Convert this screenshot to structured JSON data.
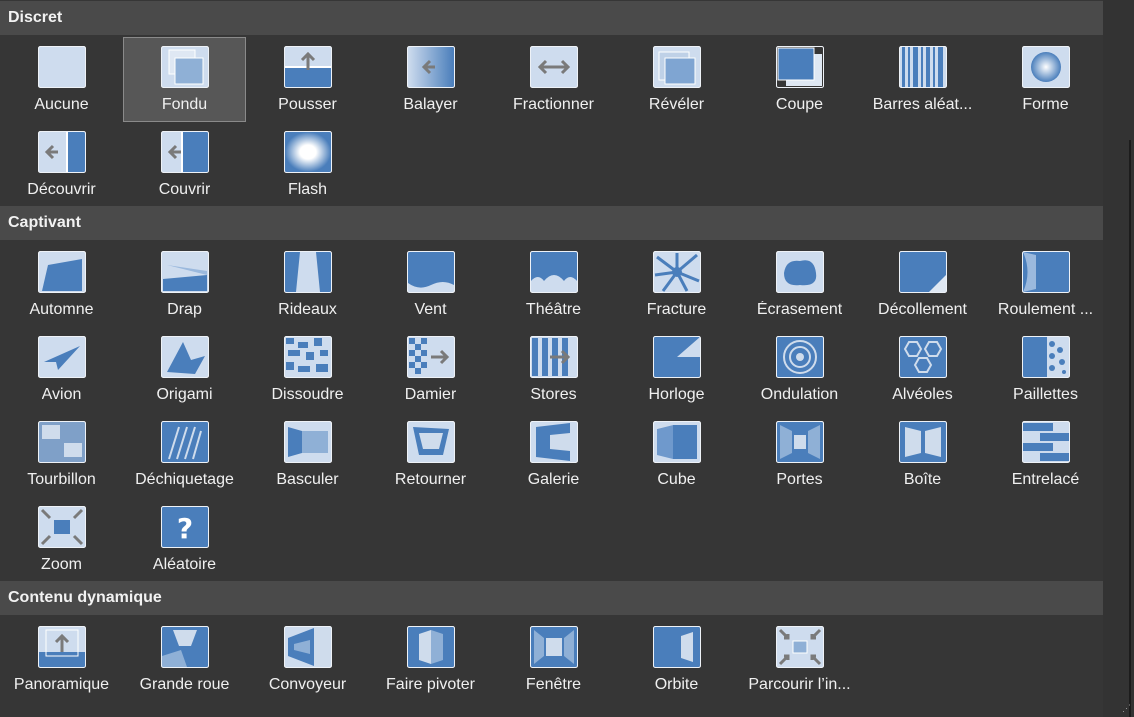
{
  "colors": {
    "icon_bg": "#cedcee",
    "icon_blue": "#4a7ebb",
    "icon_border": "#eef2f7",
    "arrow": "#7a7a7a"
  },
  "sections": [
    {
      "title": "Discret",
      "items": [
        {
          "label": "Aucune",
          "icon": "none-icon"
        },
        {
          "label": "Fondu",
          "icon": "fade-icon",
          "selected": true
        },
        {
          "label": "Pousser",
          "icon": "push-icon"
        },
        {
          "label": "Balayer",
          "icon": "wipe-icon"
        },
        {
          "label": "Fractionner",
          "icon": "split-icon"
        },
        {
          "label": "Révéler",
          "icon": "reveal-icon"
        },
        {
          "label": "Coupe",
          "icon": "cut-icon"
        },
        {
          "label": "Barres aléat...",
          "icon": "random-bars-icon"
        },
        {
          "label": "Forme",
          "icon": "shape-icon"
        },
        {
          "label": "Découvrir",
          "icon": "uncover-icon"
        },
        {
          "label": "Couvrir",
          "icon": "cover-icon"
        },
        {
          "label": "Flash",
          "icon": "flash-icon"
        }
      ]
    },
    {
      "title": "Captivant",
      "items": [
        {
          "label": "Automne",
          "icon": "fall-over-icon"
        },
        {
          "label": "Drap",
          "icon": "drape-icon"
        },
        {
          "label": "Rideaux",
          "icon": "curtains-icon"
        },
        {
          "label": "Vent",
          "icon": "wind-icon"
        },
        {
          "label": "Théâtre",
          "icon": "prestige-icon"
        },
        {
          "label": "Fracture",
          "icon": "fracture-icon"
        },
        {
          "label": "Écrasement",
          "icon": "crush-icon"
        },
        {
          "label": "Décollement",
          "icon": "peel-off-icon"
        },
        {
          "label": "Roulement ...",
          "icon": "page-curl-icon"
        },
        {
          "label": "Avion",
          "icon": "airplane-icon"
        },
        {
          "label": "Origami",
          "icon": "origami-icon"
        },
        {
          "label": "Dissoudre",
          "icon": "dissolve-icon"
        },
        {
          "label": "Damier",
          "icon": "checkerboard-icon"
        },
        {
          "label": "Stores",
          "icon": "blinds-icon"
        },
        {
          "label": "Horloge",
          "icon": "clock-icon"
        },
        {
          "label": "Ondulation",
          "icon": "ripple-icon"
        },
        {
          "label": "Alvéoles",
          "icon": "honeycomb-icon"
        },
        {
          "label": "Paillettes",
          "icon": "glitter-icon"
        },
        {
          "label": "Tourbillon",
          "icon": "vortex-icon"
        },
        {
          "label": "Déchiquetage",
          "icon": "shred-icon"
        },
        {
          "label": "Basculer",
          "icon": "switch-icon"
        },
        {
          "label": "Retourner",
          "icon": "flip-icon"
        },
        {
          "label": "Galerie",
          "icon": "gallery-icon"
        },
        {
          "label": "Cube",
          "icon": "cube-icon"
        },
        {
          "label": "Portes",
          "icon": "doors-icon"
        },
        {
          "label": "Boîte",
          "icon": "box-icon"
        },
        {
          "label": "Entrelacé",
          "icon": "comb-icon"
        },
        {
          "label": "Zoom",
          "icon": "zoom-icon"
        },
        {
          "label": "Aléatoire",
          "icon": "random-icon"
        }
      ]
    },
    {
      "title": "Contenu dynamique",
      "items": [
        {
          "label": "Panoramique",
          "icon": "pan-icon"
        },
        {
          "label": "Grande roue",
          "icon": "ferris-wheel-icon"
        },
        {
          "label": "Convoyeur",
          "icon": "conveyor-icon"
        },
        {
          "label": "Faire pivoter",
          "icon": "rotate-icon"
        },
        {
          "label": "Fenêtre",
          "icon": "window-icon"
        },
        {
          "label": "Orbite",
          "icon": "orbit-icon"
        },
        {
          "label": "Parcourir l’in...",
          "icon": "fly-through-icon"
        }
      ]
    }
  ]
}
